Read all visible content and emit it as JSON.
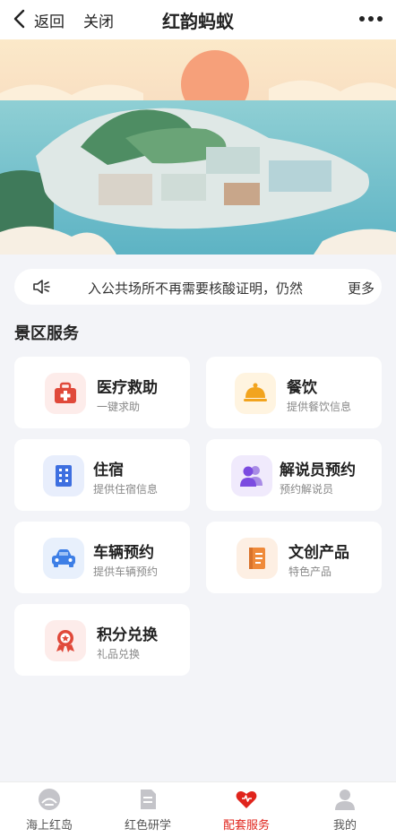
{
  "header": {
    "back_label": "返回",
    "close_label": "关闭",
    "title": "红韵蚂蚁"
  },
  "notice": {
    "text": "入公共场所不再需要核酸证明，仍然",
    "more_label": "更多"
  },
  "section_title": "景区服务",
  "services": [
    {
      "title": "医疗救助",
      "subtitle": "一键求助",
      "icon": "first-aid-kit-icon",
      "color": "#e0493a",
      "bg": "#fdecea"
    },
    {
      "title": "餐饮",
      "subtitle": "提供餐饮信息",
      "icon": "food-cloche-icon",
      "color": "#f2a41e",
      "bg": "#fff4e0"
    },
    {
      "title": "住宿",
      "subtitle": "提供住宿信息",
      "icon": "building-icon",
      "color": "#3e6fe0",
      "bg": "#e8eefc"
    },
    {
      "title": "解说员预约",
      "subtitle": "预约解说员",
      "icon": "people-icon",
      "color": "#7b4be0",
      "bg": "#f0eafc"
    },
    {
      "title": "车辆预约",
      "subtitle": "提供车辆预约",
      "icon": "car-icon",
      "color": "#3e7fe6",
      "bg": "#e8f0fc"
    },
    {
      "title": "文创产品",
      "subtitle": "特色产品",
      "icon": "notebook-icon",
      "color": "#ef8a3a",
      "bg": "#fdefe3"
    },
    {
      "title": "积分兑换",
      "subtitle": "礼品兑换",
      "icon": "medal-icon",
      "color": "#e0493a",
      "bg": "#fdecea"
    }
  ],
  "tabs": [
    {
      "label": "海上红岛",
      "icon": "island-icon",
      "active": false
    },
    {
      "label": "红色研学",
      "icon": "document-icon",
      "active": false
    },
    {
      "label": "配套服务",
      "icon": "heart-icon",
      "active": true
    },
    {
      "label": "我的",
      "icon": "user-icon",
      "active": false
    }
  ],
  "colors": {
    "accent": "#e0241c",
    "background": "#f3f4f8"
  }
}
